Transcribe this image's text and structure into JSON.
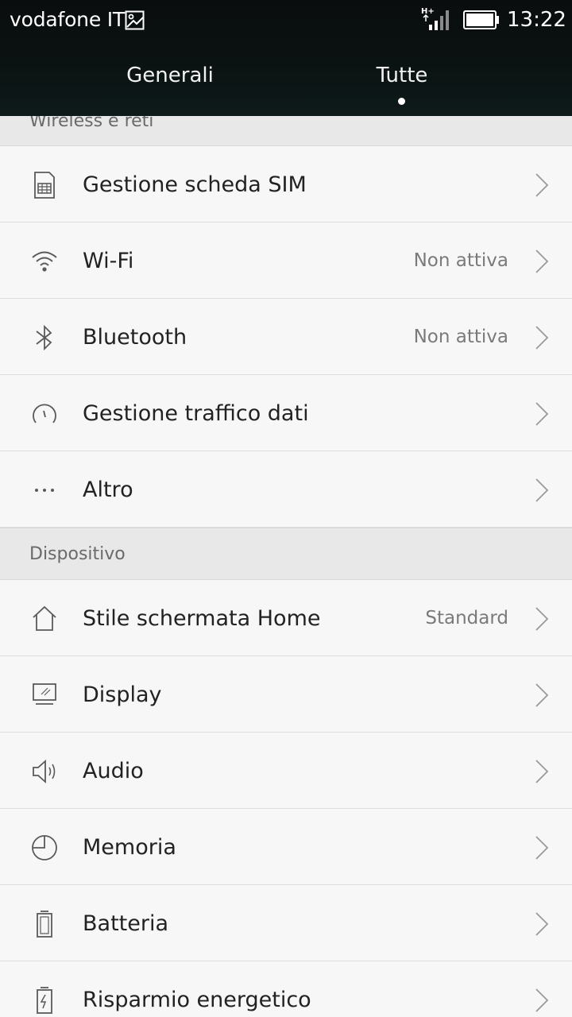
{
  "status_bar": {
    "carrier": "vodafone IT",
    "time": "13:22",
    "network_label": "H+"
  },
  "tabs": [
    {
      "label": "Generali",
      "selected": false
    },
    {
      "label": "Tutte",
      "selected": true
    }
  ],
  "sections": [
    {
      "title": "Wireless e reti",
      "items": [
        {
          "label": "Gestione scheda SIM",
          "value": "",
          "icon": "sim-card-icon"
        },
        {
          "label": "Wi-Fi",
          "value": "Non attiva",
          "icon": "wifi-icon"
        },
        {
          "label": "Bluetooth",
          "value": "Non attiva",
          "icon": "bluetooth-icon"
        },
        {
          "label": "Gestione traffico dati",
          "value": "",
          "icon": "data-usage-icon"
        },
        {
          "label": "Altro",
          "value": "",
          "icon": "more-icon"
        }
      ]
    },
    {
      "title": "Dispositivo",
      "items": [
        {
          "label": "Stile schermata Home",
          "value": "Standard",
          "icon": "home-icon"
        },
        {
          "label": "Display",
          "value": "",
          "icon": "display-icon"
        },
        {
          "label": "Audio",
          "value": "",
          "icon": "speaker-icon"
        },
        {
          "label": "Memoria",
          "value": "",
          "icon": "storage-pie-icon"
        },
        {
          "label": "Batteria",
          "value": "",
          "icon": "battery-icon"
        },
        {
          "label": "Risparmio energetico",
          "value": "",
          "icon": "power-saving-icon"
        }
      ]
    }
  ],
  "colors": {
    "topbar": "#0b1212",
    "background": "#f7f7f7",
    "section_header": "#e8e8e8",
    "icon_stroke": "#5a5a5a"
  }
}
